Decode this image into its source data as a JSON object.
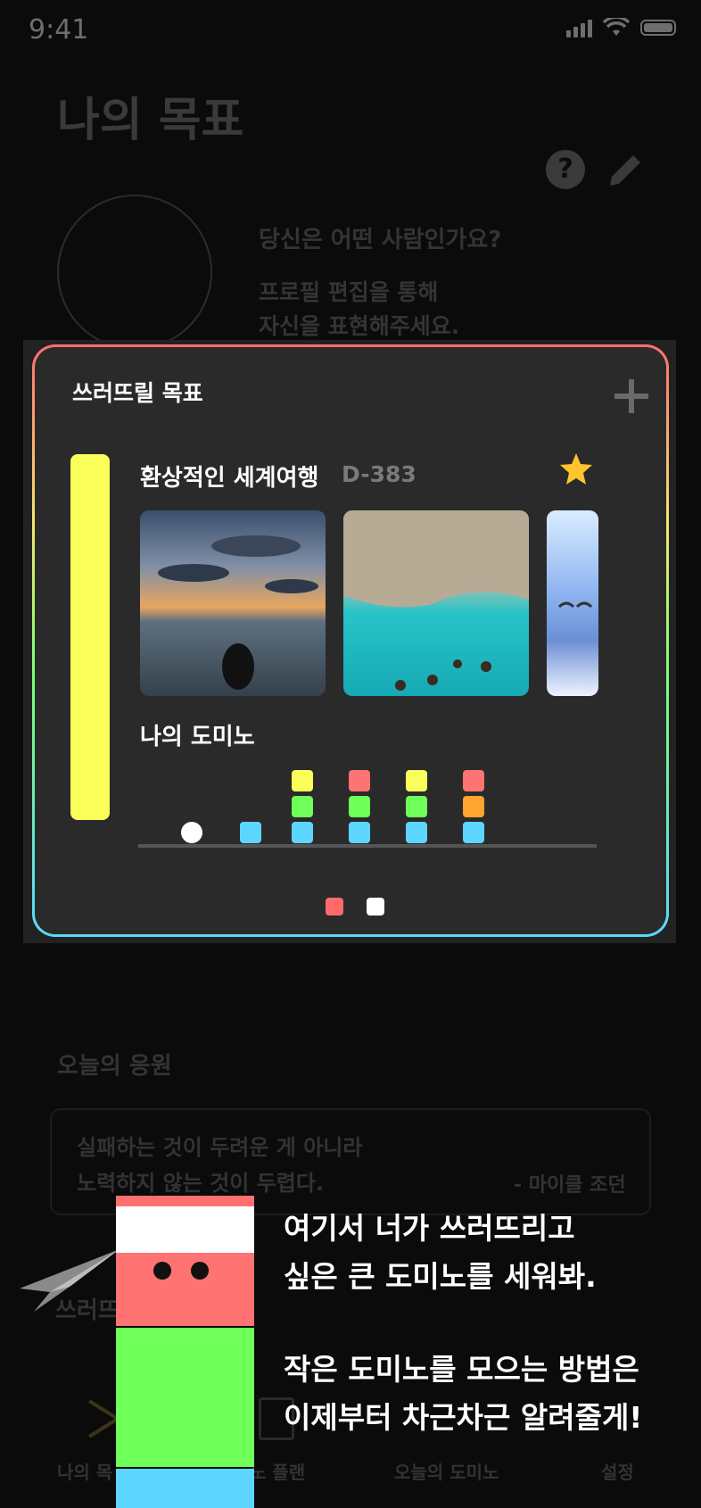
{
  "status": {
    "time": "9:41"
  },
  "background": {
    "page_title": "나의 목표",
    "profile_question": "당신은 어떤 사람인가요?",
    "profile_hint_line1": "프로필 편집을 통해",
    "profile_hint_line2": "자신을 표현해주세요.",
    "cheer_title": "오늘의 응원",
    "quote_line1": "실패하는 것이 두려운 게 아니라",
    "quote_line2": "노력하지 않는 것이 두렵다.",
    "quote_author": "- 마이클 조던",
    "section2_title": "쓰러뜨"
  },
  "tabbar": {
    "tabs": [
      {
        "label": "나의 목"
      },
      {
        "label": "노 플랜"
      },
      {
        "label": "오늘의 도미노"
      },
      {
        "label": "설정"
      }
    ]
  },
  "card": {
    "title": "쓰러뜨릴 목표",
    "goal_name": "환상적인 세계여행",
    "goal_dday": "D-383",
    "domino_title": "나의 도미노",
    "colors": {
      "yellow": "#fbff59",
      "red": "#ff7373",
      "green": "#6fff59",
      "blue": "#5dd6ff",
      "orange": "#ffa42e",
      "goal_bar": "#fbff59"
    },
    "domino_columns": [
      [
        "white-circle"
      ],
      [
        "blue"
      ],
      [
        "blue",
        "green",
        "yellow"
      ],
      [
        "blue",
        "green",
        "red"
      ],
      [
        "blue",
        "green",
        "yellow"
      ],
      [
        "blue",
        "orange",
        "red"
      ]
    ],
    "page_indicator": {
      "pages": 2,
      "current": 1
    }
  },
  "coach": {
    "line1": "여기서 너가 쓰러뜨리고",
    "line2": "싶은 큰 도미노를 세워봐.",
    "line3": "작은 도미노를 모으는 방법은",
    "line4": "이제부터 차근차근 알려줄게!"
  }
}
